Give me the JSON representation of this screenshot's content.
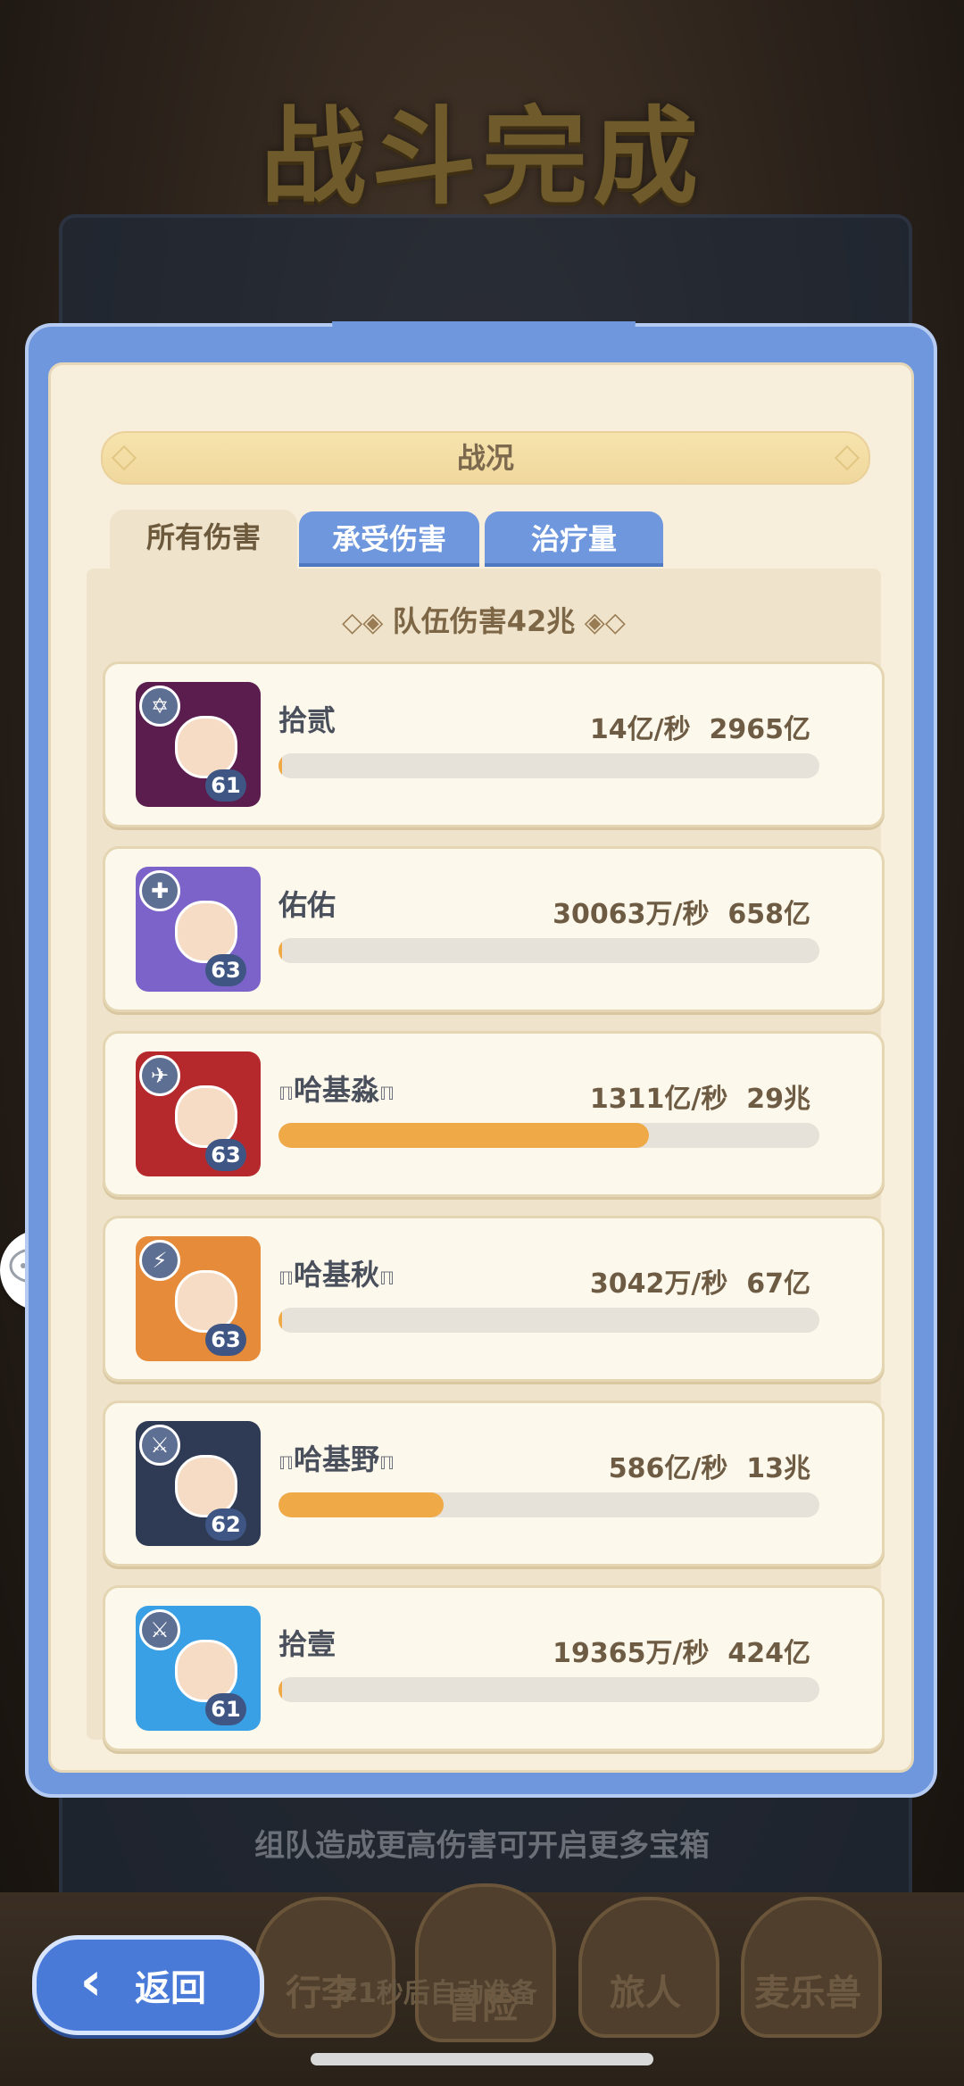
{
  "background": {
    "title": "战斗完成",
    "tip": "组队造成更高伤害可开启更多宝箱",
    "nav_items": [
      "行李",
      "冒险",
      "旅人",
      "麦乐兽"
    ],
    "nav_mid_text": "71秒后自动准备"
  },
  "modal": {
    "header": "战况",
    "tabs": [
      {
        "label": "所有伤害",
        "active": true
      },
      {
        "label": "承受伤害",
        "active": false
      },
      {
        "label": "治疗量",
        "active": false
      }
    ],
    "team_damage": "队伍伤害42兆"
  },
  "rows": [
    {
      "name": "拾贰",
      "level": "61",
      "dps": "14亿/秒",
      "total": "2965亿",
      "progress": 0.006,
      "avatar_color": "#5a1d4e",
      "class_icon": "hexagram-icon"
    },
    {
      "name": "佑佑",
      "level": "63",
      "dps": "30063万/秒",
      "total": "658亿",
      "progress": 0.003,
      "avatar_color": "#7b63c9",
      "class_icon": "cross-icon"
    },
    {
      "name": "哈基淼",
      "level": "63",
      "dps": "1311亿/秒",
      "total": "29兆",
      "progress": 0.685,
      "avatar_color": "#b5292d",
      "class_icon": "plane-icon",
      "marks": true
    },
    {
      "name": "哈基秋",
      "level": "63",
      "dps": "3042万/秒",
      "total": "67亿",
      "progress": 0.001,
      "avatar_color": "#e68b3a",
      "class_icon": "split-icon",
      "marks": true
    },
    {
      "name": "哈基野",
      "level": "62",
      "dps": "586亿/秒",
      "total": "13兆",
      "progress": 0.305,
      "avatar_color": "#2f3a55",
      "class_icon": "sword-icon",
      "marks": true
    },
    {
      "name": "拾壹",
      "level": "61",
      "dps": "19365万/秒",
      "total": "424亿",
      "progress": 0.003,
      "avatar_color": "#3aa0e6",
      "class_icon": "sword-icon"
    }
  ],
  "back_button": {
    "label": "返回"
  }
}
